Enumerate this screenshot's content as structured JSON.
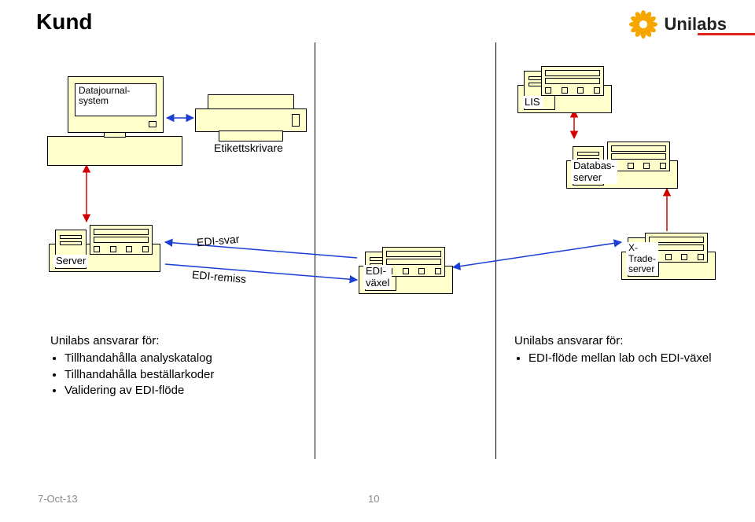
{
  "title": "Kund",
  "brand": {
    "name": "Unilabs"
  },
  "devices": {
    "pc": {
      "label": "Datajournal-\nsystem"
    },
    "printer": {
      "label": "Etikettskrivare"
    },
    "server_left": {
      "label": "Server"
    },
    "lis": {
      "label": "LIS"
    },
    "db": {
      "label": "Databas-\nserver"
    },
    "edi": {
      "label": "EDI-\nväxel"
    },
    "xtrade": {
      "label": "X-\nTrade-\nserver"
    }
  },
  "flows": {
    "edi_svar": "EDI-svar",
    "edi_remiss": "EDI-remiss"
  },
  "bullets_left": {
    "heading": "Unilabs ansvarar för:",
    "items": [
      "Tillhandahålla analyskatalog",
      "Tillhandahålla beställarkoder",
      "Validering av EDI-flöde"
    ]
  },
  "bullets_right": {
    "heading": "Unilabs ansvarar för:",
    "items": [
      "EDI-flöde mellan lab och EDI-växel"
    ]
  },
  "footer": {
    "date": "7-Oct-13",
    "page": "10"
  }
}
